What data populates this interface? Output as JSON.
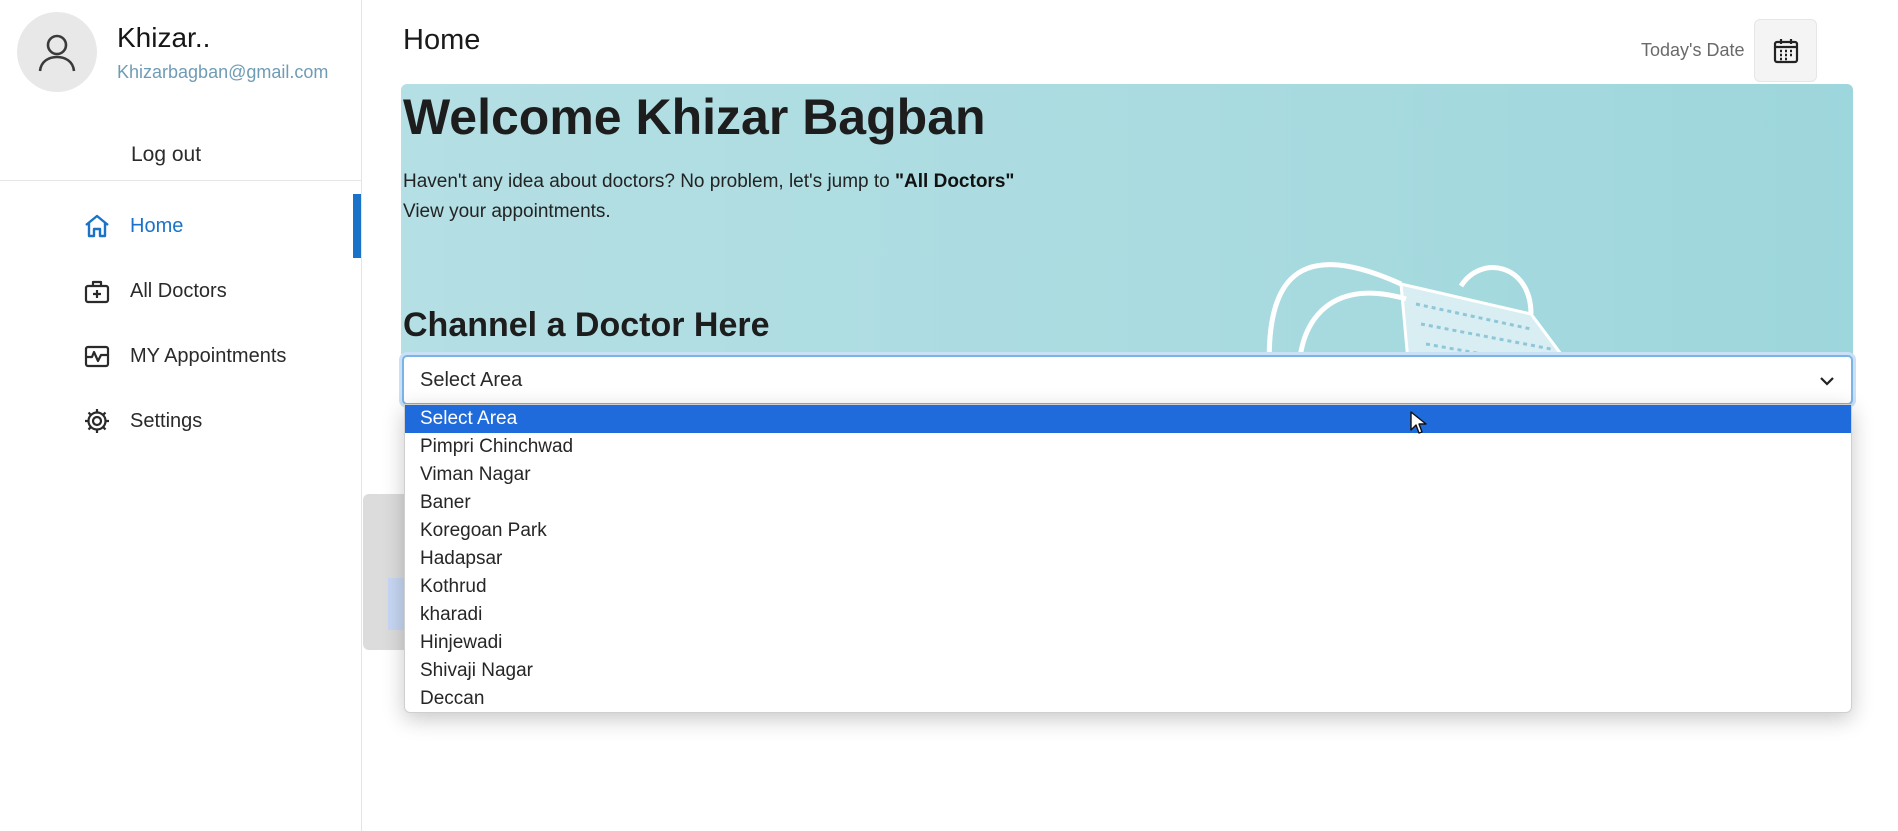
{
  "profile": {
    "name": "Khizar..",
    "email": "Khizarbagban@gmail.com",
    "logout_label": "Log out"
  },
  "nav": {
    "items": [
      {
        "label": "Home",
        "icon": "home-icon",
        "active": true
      },
      {
        "label": "All Doctors",
        "icon": "medical-bag-icon",
        "active": false
      },
      {
        "label": "MY Appointments",
        "icon": "activity-icon",
        "active": false
      },
      {
        "label": "Settings",
        "icon": "gear-icon",
        "active": false
      }
    ]
  },
  "header": {
    "title": "Home",
    "today_label": "Today's Date",
    "calendar_icon": "calendar-icon"
  },
  "banner": {
    "welcome": "Welcome Khizar Bagban",
    "line1_prefix": "Haven't any idea about doctors? No problem, let's jump to ",
    "line1_link": "\"All Doctors\"",
    "line2": "View your appointments.",
    "channel_title": "Channel a Doctor Here"
  },
  "area_select": {
    "value": "Select Area",
    "options": [
      "Select Area",
      "Pimpri Chinchwad",
      "Viman Nagar",
      "Baner",
      "Koregoan Park",
      "Hadapsar",
      "Kothrud",
      "kharadi",
      "Hinjewadi",
      "Shivaji Nagar",
      "Deccan"
    ],
    "highlighted_index": 0
  },
  "colors": {
    "accent": "#1a73c9",
    "option_highlight": "#1f6bdc",
    "banner_bg": "#a9dbe0"
  }
}
